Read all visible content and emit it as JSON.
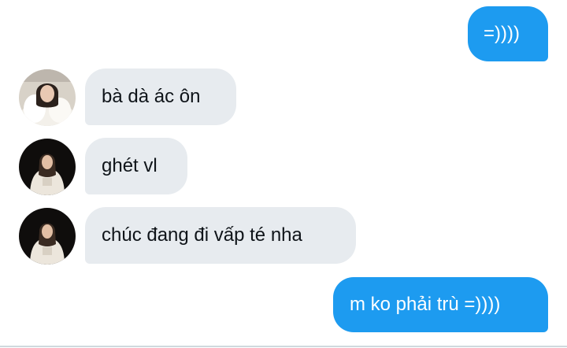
{
  "messages": [
    {
      "direction": "outgoing",
      "text": "=))))"
    },
    {
      "direction": "incoming",
      "text": "bà dà ác ôn",
      "avatar": "avatar-photo-white-fur"
    },
    {
      "direction": "incoming",
      "text": "ghét vl",
      "avatar": "avatar-photo-night-portrait"
    },
    {
      "direction": "incoming",
      "text": "chúc đang đi vấp té nha",
      "avatar": "avatar-photo-night-portrait"
    },
    {
      "direction": "outgoing",
      "text": "m ko phải trù =))))"
    }
  ],
  "colors": {
    "outgoing_bubble": "#1d9bf0",
    "incoming_bubble": "#e7ebef",
    "incoming_text": "#0f1419",
    "outgoing_text": "#ffffff"
  }
}
